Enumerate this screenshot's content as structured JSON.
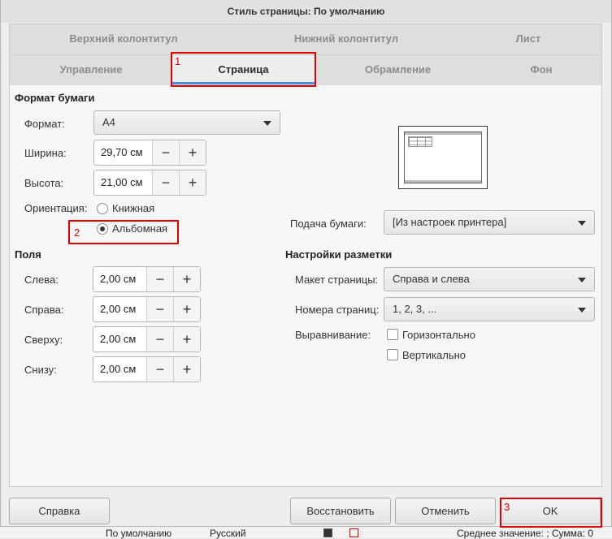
{
  "dialog": {
    "title": "Стиль страницы: По умолчанию"
  },
  "tabs": {
    "row1": [
      "Верхний колонтитул",
      "Нижний колонтитул",
      "Лист"
    ],
    "row2": [
      "Управление",
      "Страница",
      "Обрамление",
      "Фон"
    ],
    "active": "Страница"
  },
  "paper": {
    "section": "Формат бумаги",
    "format_label": "Формат:",
    "format_value": "A4",
    "width_label": "Ширина:",
    "width_value": "29,70 см",
    "height_label": "Высота:",
    "height_value": "21,00 см",
    "orientation_label": "Ориентация:",
    "portrait": "Книжная",
    "landscape": "Альбомная",
    "selected_orientation": "landscape",
    "tray_label": "Подача бумаги:",
    "tray_value": "[Из настроек принтера]"
  },
  "margins": {
    "section": "Поля",
    "left_label": "Слева:",
    "left_value": "2,00 см",
    "right_label": "Справа:",
    "right_value": "2,00 см",
    "top_label": "Сверху:",
    "top_value": "2,00 см",
    "bottom_label": "Снизу:",
    "bottom_value": "2,00 см"
  },
  "layout": {
    "section": "Настройки разметки",
    "page_layout_label": "Макет страницы:",
    "page_layout_value": "Справа и слева",
    "page_numbers_label": "Номера страниц:",
    "page_numbers_value": "1, 2, 3, ...",
    "alignment_label": "Выравнивание:",
    "horizontal": "Горизонтально",
    "vertical": "Вертикально"
  },
  "spin": {
    "minus": "−",
    "plus": "+"
  },
  "buttons": {
    "help": "Справка",
    "reset": "Восстановить",
    "cancel": "Отменить",
    "ok": "OK"
  },
  "annotations": [
    "1",
    "2",
    "3"
  ],
  "background": {
    "digit": "1",
    "status": [
      "По умолчанию",
      "Русский",
      "Среднее значение: ; Сумма: 0"
    ]
  },
  "colors": {
    "annotation": "#e00000",
    "active_tab_underline": "#4a90d9"
  }
}
